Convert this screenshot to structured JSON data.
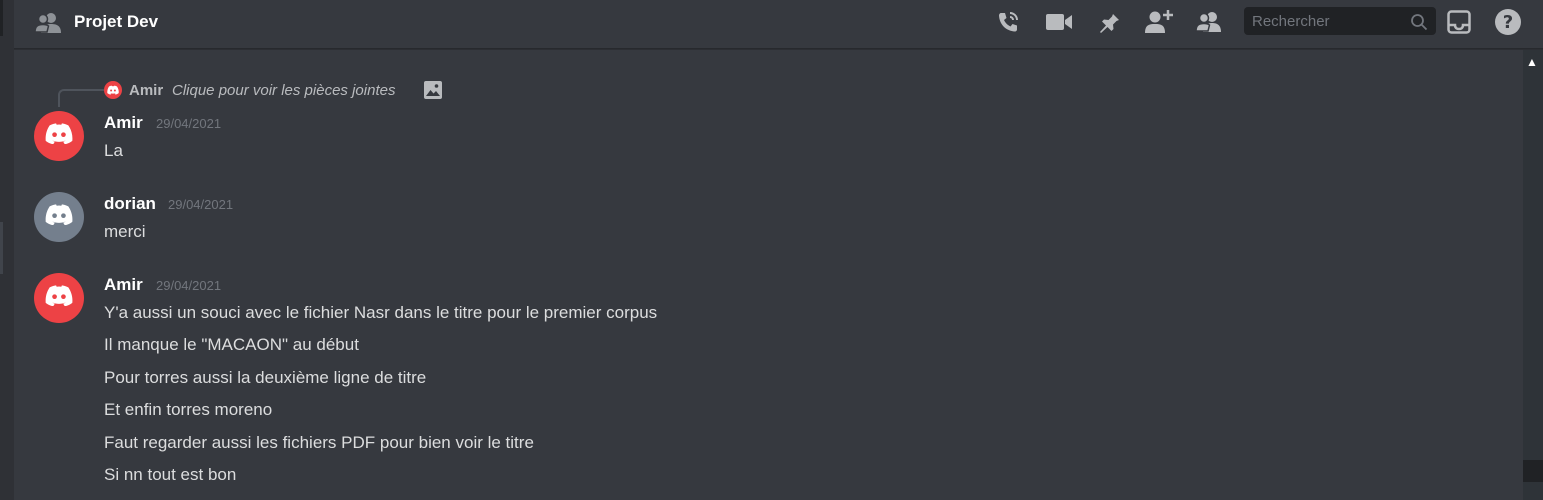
{
  "header": {
    "title": "Projet Dev",
    "channel_icon": "group-dm-icon",
    "toolbar": [
      {
        "name": "call-icon",
        "label": "Start voice call"
      },
      {
        "name": "video-icon",
        "label": "Start video call"
      },
      {
        "name": "pin-icon",
        "label": "Pinned messages"
      },
      {
        "name": "add-friend-icon",
        "label": "Add friends to DM"
      },
      {
        "name": "members-icon",
        "label": "Member list"
      },
      {
        "name": "inbox-icon",
        "label": "Inbox"
      },
      {
        "name": "help-icon",
        "label": "Help"
      }
    ],
    "search": {
      "placeholder": "Rechercher",
      "icon": "search-icon"
    }
  },
  "reply": {
    "author": "Amir",
    "text": "Clique pour voir les pièces jointes",
    "attachment_icon": "image-icon"
  },
  "messages": [
    {
      "author": "Amir",
      "timestamp": "29/04/2021",
      "avatar_color": "#ed4245",
      "lines": [
        "La"
      ]
    },
    {
      "author": "dorian",
      "timestamp": "29/04/2021",
      "avatar_color": "#747f8d",
      "lines": [
        "merci"
      ]
    },
    {
      "author": "Amir",
      "timestamp": "29/04/2021",
      "avatar_color": "#ed4245",
      "lines": [
        "Y'a aussi un souci avec le fichier Nasr dans le titre pour le premier corpus",
        "Il manque le \"MACAON\" au début",
        "Pour torres aussi la deuxième ligne de titre",
        "Et enfin torres moreno",
        "Faut regarder aussi les fichiers PDF pour bien voir le titre",
        "Si nn tout est bon"
      ]
    }
  ],
  "colors": {
    "background": "#36393f",
    "sidebar": "#2f3136",
    "username": "#ffffff",
    "text": "#dcddde",
    "muted": "#72767d",
    "red_avatar": "#ed4245",
    "grey_avatar": "#747f8d"
  }
}
